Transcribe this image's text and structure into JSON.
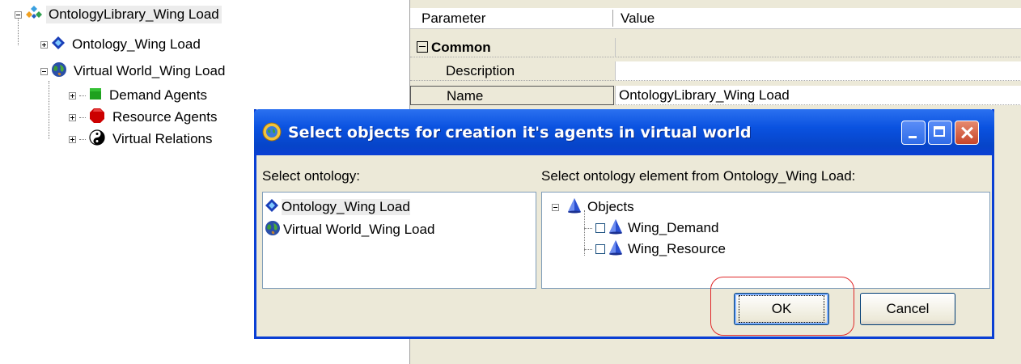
{
  "tree": {
    "root": "OntologyLibrary_Wing Load",
    "ontology": "Ontology_Wing Load",
    "world": "Virtual World_Wing Load",
    "children": [
      "Demand Agents",
      "Resource Agents",
      "Virtual Relations"
    ]
  },
  "grid": {
    "header": {
      "parameter": "Parameter",
      "value": "Value"
    },
    "group": "Common",
    "rows": [
      {
        "param": "Description",
        "value": ""
      },
      {
        "param": "Name",
        "value": "OntologyLibrary_Wing Load"
      }
    ]
  },
  "dialog": {
    "title": "Select objects for creation it's agents in virtual world",
    "left_label": "Select ontology:",
    "right_label": "Select ontology element from Ontology_Wing Load:",
    "ontologies": [
      "Ontology_Wing Load",
      "Virtual World_Wing Load"
    ],
    "elements_root": "Objects",
    "elements": [
      "Wing_Demand",
      "Wing_Resource"
    ],
    "ok_label": "OK",
    "cancel_label": "Cancel"
  },
  "colors": {
    "titlebar": "#0a52e0",
    "highlight": "#e0292a",
    "demand_icon": "#1fa11f",
    "resource_icon": "#cc0000",
    "ontology_icon": "#1a3fb8"
  }
}
